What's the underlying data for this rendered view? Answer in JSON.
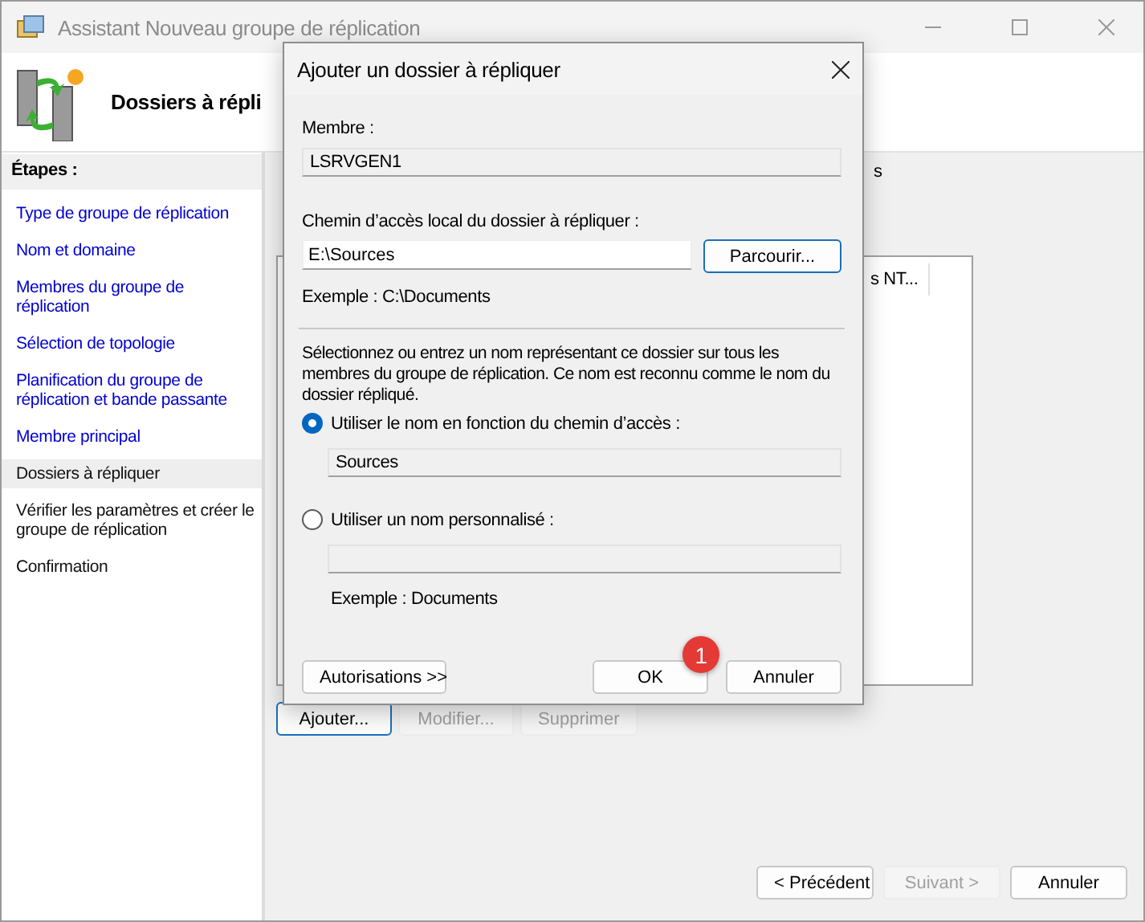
{
  "window": {
    "title": "Assistant Nouveau groupe de réplication"
  },
  "header": {
    "title": "Dossiers à répli"
  },
  "steps_title": "Étapes :",
  "steps": [
    {
      "label": "Type de groupe de réplication",
      "completed": true,
      "selected": false
    },
    {
      "label": "Nom et domaine",
      "completed": true,
      "selected": false
    },
    {
      "label": "Membres du groupe de réplication",
      "completed": true,
      "selected": false
    },
    {
      "label": "Sélection de topologie",
      "completed": true,
      "selected": false
    },
    {
      "label": "Planification du groupe de réplication et bande passante",
      "completed": true,
      "selected": false
    },
    {
      "label": "Membre principal",
      "completed": true,
      "selected": false
    },
    {
      "label": "Dossiers à répliquer",
      "completed": false,
      "selected": true
    },
    {
      "label": "Vérifier les paramètres et créer le groupe de réplication",
      "completed": false,
      "selected": false
    },
    {
      "label": "Confirmation",
      "completed": false,
      "selected": false
    }
  ],
  "content": {
    "text_fragment": "s",
    "table": {
      "column_1": "s NT..."
    },
    "list_buttons": [
      {
        "label": "Ajouter...",
        "disabled": false
      },
      {
        "label": "Modifier...",
        "disabled": true
      },
      {
        "label": "Supprimer",
        "disabled": true
      }
    ]
  },
  "footer_buttons": [
    {
      "label": "< Précédent",
      "disabled": false
    },
    {
      "label": "Suivant >",
      "disabled": true
    },
    {
      "label": "Annuler",
      "disabled": false
    }
  ],
  "dialog": {
    "title": "Ajouter un dossier à répliquer",
    "member_label": "Membre :",
    "member_value": "LSRVGEN1",
    "path_label": "Chemin d’accès local du dossier à répliquer :",
    "path_value": "E:\\Sources",
    "browse_button": "Parcourir...",
    "path_example": "Exemple : C:\\Documents",
    "description": "Sélectionnez ou entrez un nom représentant ce dossier sur tous les membres du groupe de réplication. Ce nom est reconnu comme le nom du dossier répliqué.",
    "options": [
      {
        "label": "Utiliser le nom en fonction du chemin d’accès :",
        "selected": true,
        "value": "Sources"
      },
      {
        "label": "Utiliser un nom personnalisé :",
        "selected": false
      }
    ],
    "name_example": "Exemple : Documents",
    "permissions_button": "Autorisations >>",
    "ok_button": "OK",
    "cancel_button": "Annuler",
    "badge": "1"
  }
}
